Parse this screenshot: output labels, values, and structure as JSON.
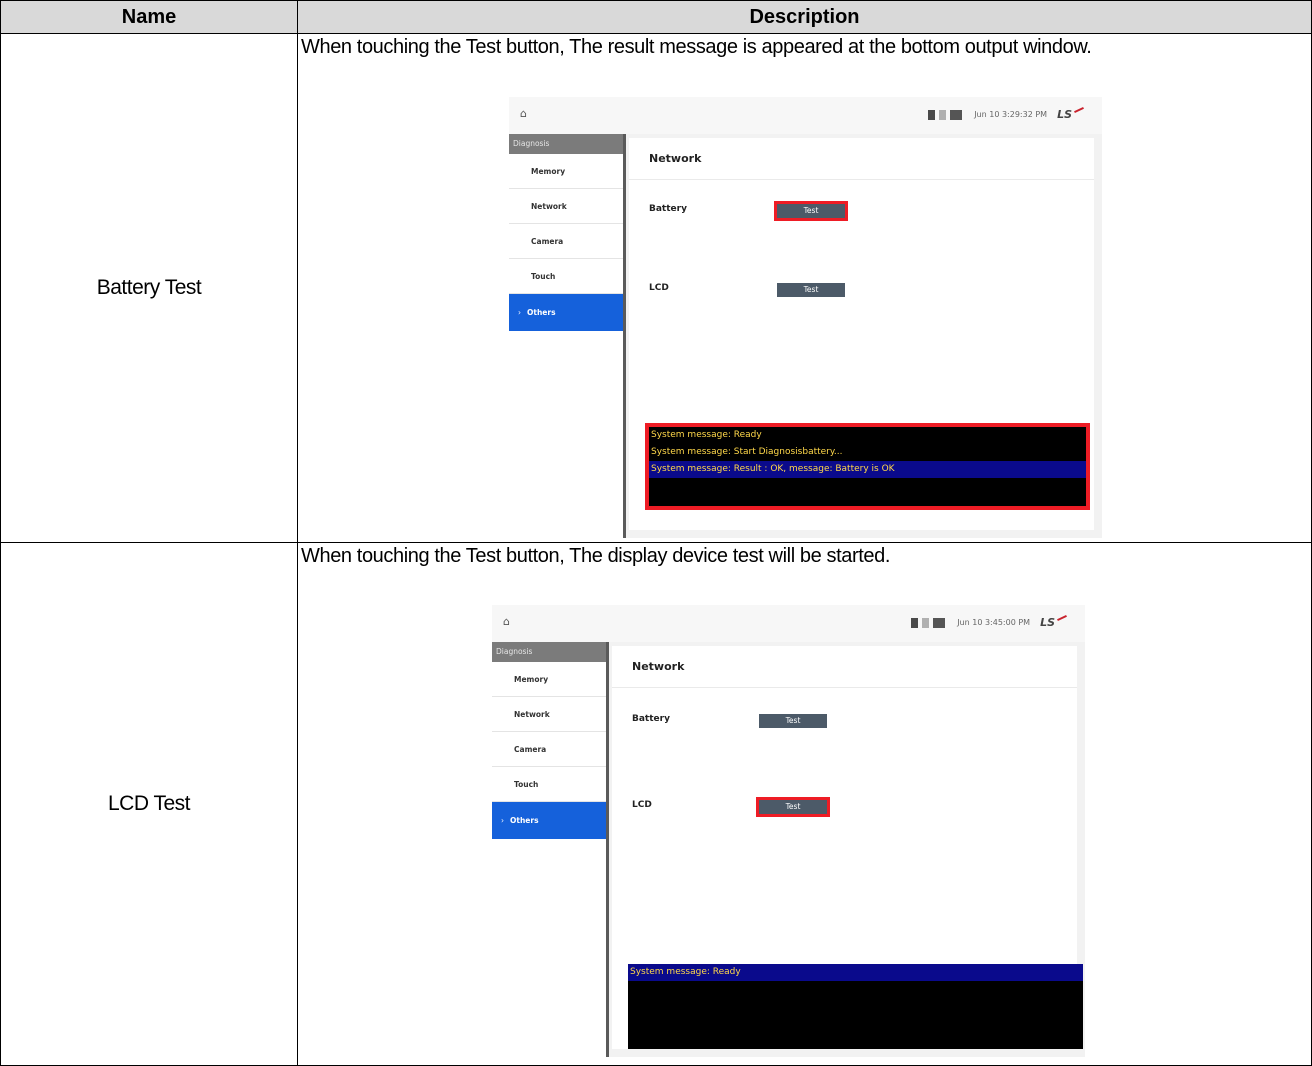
{
  "table": {
    "header_name": "Name",
    "header_description": "Description"
  },
  "rows": [
    {
      "name": "Battery Test",
      "description": "When touching the Test button, The result message is appeared at the bottom output window.",
      "screen": {
        "home_icon": "home-icon",
        "datetime": "Jun 10 3:29:32 PM",
        "logo": "LS",
        "sidebar_header": "Diagnosis",
        "sidebar_items": [
          "Memory",
          "Network",
          "Camera",
          "Touch",
          "Others"
        ],
        "active_item": "Others",
        "panel_title": "Network",
        "battery_label": "Battery",
        "lcd_label": "LCD",
        "test_label": "Test",
        "highlighted_button": "Battery",
        "console_lines": [
          "System message: Ready",
          "System message: Start Diagnosisbattery...",
          "System message: Result : OK, message: Battery is OK"
        ],
        "selected_console_line": 3
      }
    },
    {
      "name": "LCD Test",
      "description": "When touching the Test button, The display device test will be started.",
      "screen": {
        "home_icon": "home-icon",
        "datetime": "Jun 10 3:45:00 PM",
        "logo": "LS",
        "sidebar_header": "Diagnosis",
        "sidebar_items": [
          "Memory",
          "Network",
          "Camera",
          "Touch",
          "Others"
        ],
        "active_item": "Others",
        "panel_title": "Network",
        "battery_label": "Battery",
        "lcd_label": "LCD",
        "test_label": "Test",
        "highlighted_button": "LCD",
        "console_lines": [
          "System message: Ready"
        ],
        "selected_console_line": 1
      }
    }
  ],
  "colors": {
    "highlight": "#ee1c25",
    "active_nav": "#1561db",
    "console_text": "#ffd84a",
    "console_selected": "#0a0a8c"
  }
}
